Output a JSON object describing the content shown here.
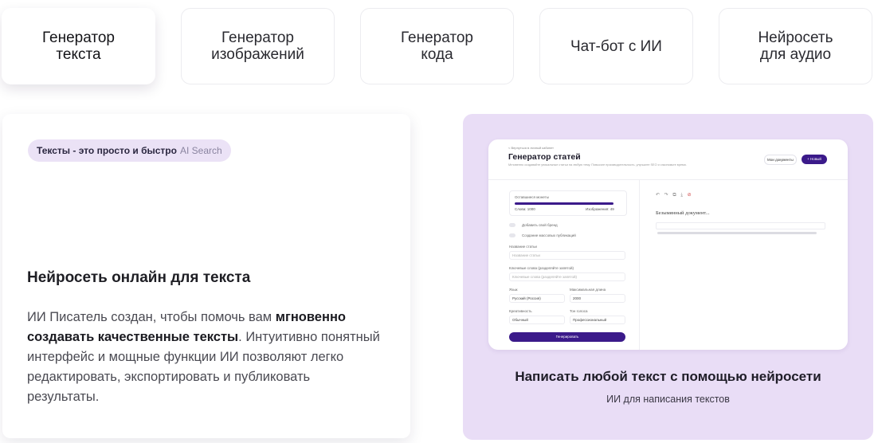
{
  "tabs": [
    {
      "label": "Генератор\nтекста",
      "active": true
    },
    {
      "label": "Генератор\nизображений",
      "active": false
    },
    {
      "label": "Генератор\nкода",
      "active": false
    },
    {
      "label": "Чат-бот с ИИ",
      "active": false
    },
    {
      "label": "Нейросеть\nдля аудио",
      "active": false
    }
  ],
  "left_card": {
    "pill_text": "Тексты - это просто и быстро",
    "pill_ai": "AI Search",
    "title": "Нейросеть онлайн для текста",
    "desc_part1": "ИИ Писатель создан, чтобы помочь вам ",
    "desc_bold": "мгновенно создавать качественные тексты",
    "desc_part2": ". Интуитивно понятный интерфейс и мощные функции ИИ позволяют легко редактировать, экспортировать и публиковать результаты."
  },
  "right_card": {
    "title": "Написать любой текст с помощью нейросети",
    "subtitle": "ИИ для написания текстов"
  },
  "preview": {
    "back_link": "< Вернуться в личный кабинет",
    "title": "Генератор статей",
    "description": "Мгновенно создавайте уникальные статьи на любую тему. Повысьте производительность, улучшите SEO и сэкономьте время.",
    "my_docs_button": "Мои документы",
    "new_button": "+ Новый",
    "words_left_label": "Оставшиеся монеты",
    "words_value": "Слова: 1000",
    "images_value": "Изображения: 49",
    "brand_toggle": "Добавить свой бренд",
    "toggle_linked": "Создание массовых публикаций",
    "article_title_label": "Название статьи",
    "article_title_placeholder": "Название статьи",
    "keywords_label": "Ключевые слова (разделяйте запятой)",
    "keywords_placeholder": "Ключевые слова (разделяйте запятой)",
    "lang_label": "Язык",
    "lang_value": "Русский (Россия)",
    "maxlen_label": "Максимальная длина",
    "maxlen_value": "2000",
    "creativity_label": "Креативность",
    "creativity_value": "Обычный",
    "tone_label": "Тон голоса",
    "tone_value": "Профессиональный",
    "generate_button": "Генерировать",
    "doc_title": "Безымянный документ..."
  },
  "colors": {
    "accent": "#3b1a8a",
    "right_bg": "#e9ddf6",
    "pill_bg": "#ebe2f6"
  }
}
